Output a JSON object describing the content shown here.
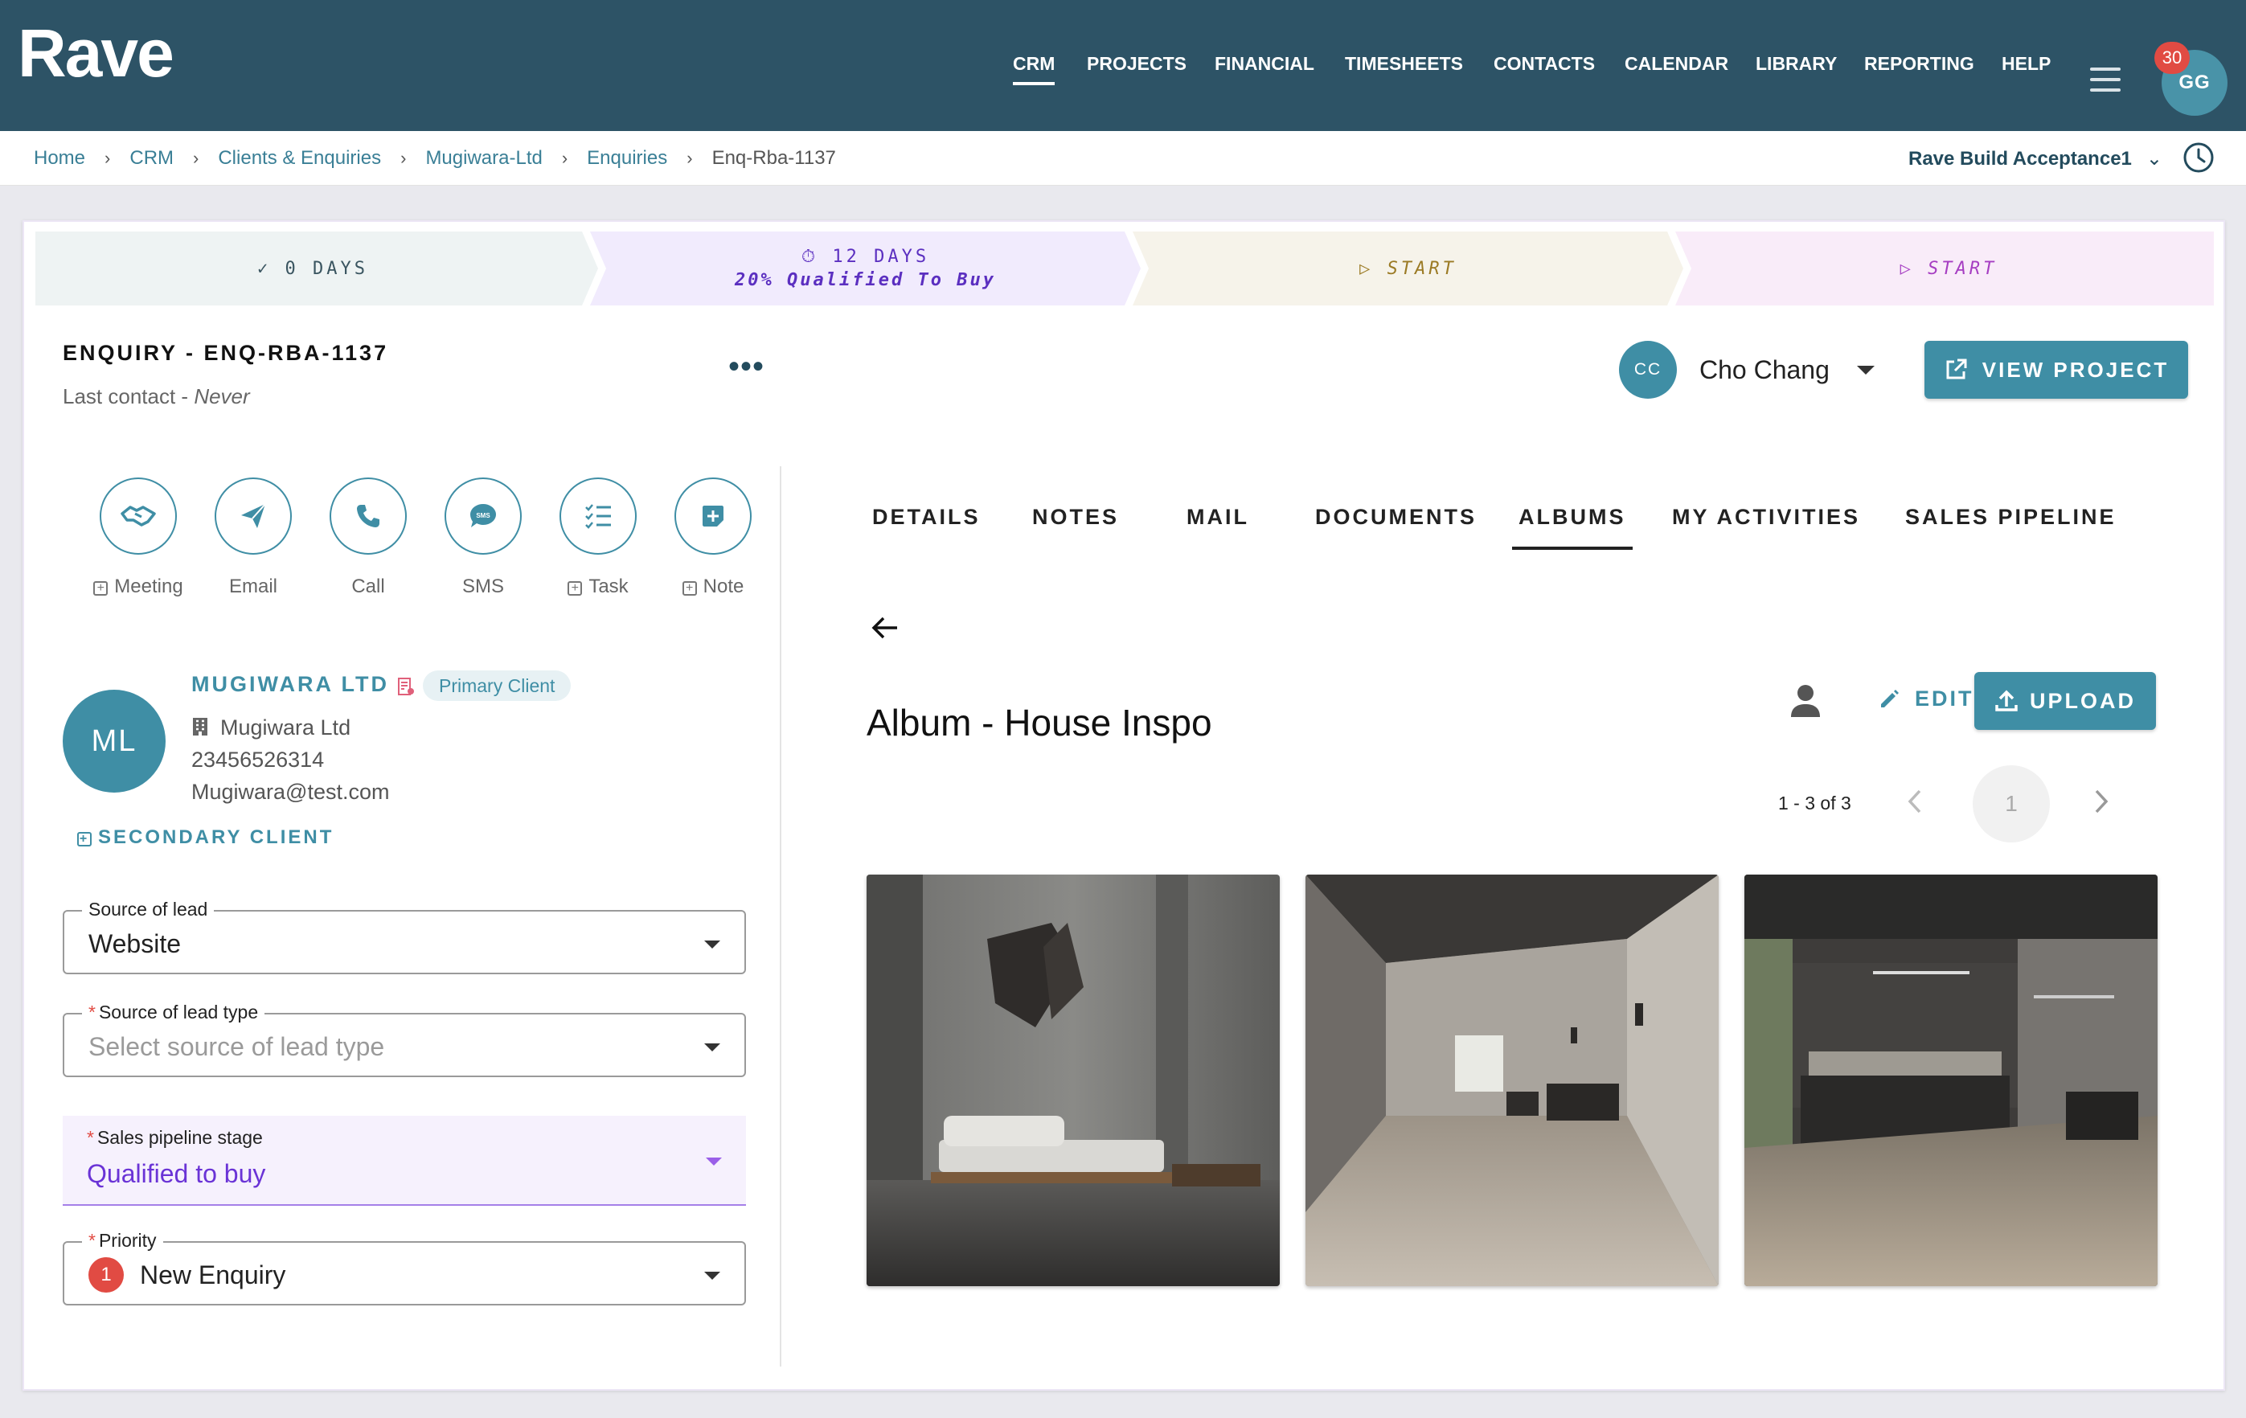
{
  "app": {
    "logo": "Rave"
  },
  "nav": [
    {
      "label": "CRM",
      "active": true
    },
    {
      "label": "PROJECTS"
    },
    {
      "label": "FINANCIAL"
    },
    {
      "label": "TIMESHEETS"
    },
    {
      "label": "CONTACTS"
    },
    {
      "label": "CALENDAR"
    },
    {
      "label": "LIBRARY"
    },
    {
      "label": "REPORTING"
    },
    {
      "label": "HELP"
    }
  ],
  "user": {
    "initials": "GG",
    "notifications": "30"
  },
  "breadcrumb": [
    "Home",
    "CRM",
    "Clients & Enquiries",
    "Mugiwara-Ltd",
    "Enquiries",
    "Enq-Rba-1137"
  ],
  "workspace": "Rave Build Acceptance1",
  "pipeline": [
    {
      "label": "0 DAYS",
      "sub": "",
      "state": "done"
    },
    {
      "label": "12 DAYS",
      "sub": "20% Qualified To Buy",
      "state": "current"
    },
    {
      "label": "START",
      "sub": "",
      "state": "pending"
    },
    {
      "label": "START",
      "sub": "",
      "state": "pending"
    }
  ],
  "enquiry": {
    "title": "ENQUIRY - ENQ-RBA-1137",
    "last_contact_label": "Last contact - ",
    "last_contact_value": "Never"
  },
  "owner": {
    "initials": "CC",
    "name": "Cho Chang"
  },
  "view_project_label": "VIEW PROJECT",
  "actions": [
    {
      "label": "Meeting",
      "icon": "handshake-icon",
      "plus": true
    },
    {
      "label": "Email",
      "icon": "send-icon",
      "plus": false
    },
    {
      "label": "Call",
      "icon": "phone-icon",
      "plus": false
    },
    {
      "label": "SMS",
      "icon": "sms-icon",
      "plus": false
    },
    {
      "label": "Task",
      "icon": "checklist-icon",
      "plus": true
    },
    {
      "label": "Note",
      "icon": "note-icon",
      "plus": true
    }
  ],
  "client": {
    "initials": "ML",
    "name": "MUGIWARA LTD",
    "badge": "Primary Client",
    "company": "Mugiwara Ltd",
    "phone": "23456526314",
    "email": "Mugiwara@test.com",
    "secondary_label": "SECONDARY CLIENT"
  },
  "form": {
    "source_of_lead": {
      "label": "Source of lead",
      "value": "Website"
    },
    "source_of_lead_type": {
      "label": "Source of lead type",
      "placeholder": "Select source of lead type",
      "required": true
    },
    "sales_stage": {
      "label": "Sales pipeline stage",
      "value": "Qualified to buy",
      "required": true
    },
    "priority": {
      "label": "Priority",
      "value": "New Enquiry",
      "badge": "1",
      "required": true
    }
  },
  "tabs": [
    {
      "label": "DETAILS"
    },
    {
      "label": "NOTES"
    },
    {
      "label": "MAIL"
    },
    {
      "label": "DOCUMENTS"
    },
    {
      "label": "ALBUMS",
      "active": true
    },
    {
      "label": "MY ACTIVITIES"
    },
    {
      "label": "SALES PIPELINE"
    }
  ],
  "album": {
    "title": "Album - House Inspo",
    "edit_label": "EDIT",
    "upload_label": "UPLOAD",
    "range": "1 - 3 of 3",
    "page": "1"
  },
  "colors": {
    "topbar": "#2d5366",
    "accent": "#3f8ea5",
    "danger": "#e14b43",
    "pipeline_done": "#eef3f3",
    "pipeline_current": "#f1ebfd",
    "pipeline_start1": "#f6f3ea",
    "pipeline_start2": "#f9ecf9"
  }
}
